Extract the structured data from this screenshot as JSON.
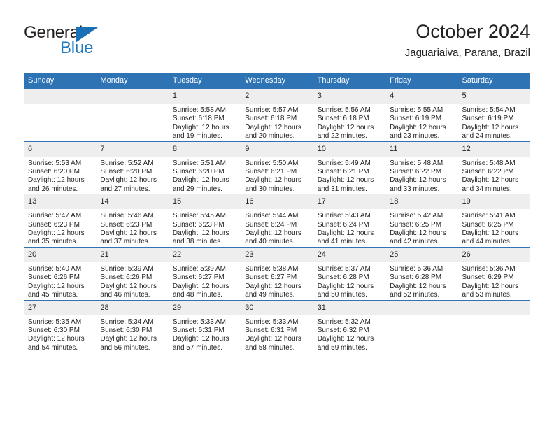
{
  "brand": {
    "name_top": "General",
    "name_bottom": "Blue",
    "triangle_icon": "triangle-icon",
    "color_dark": "#231f20",
    "color_blue": "#1f7ac0"
  },
  "header": {
    "title": "October 2024",
    "subtitle": "Jaguariaiva, Parana, Brazil"
  },
  "colors": {
    "header_bg": "#2e74b5",
    "daynum_bg": "#eeeeee",
    "text": "#222222"
  },
  "weekday_headers": [
    "Sunday",
    "Monday",
    "Tuesday",
    "Wednesday",
    "Thursday",
    "Friday",
    "Saturday"
  ],
  "weeks": [
    [
      {
        "day": ""
      },
      {
        "day": ""
      },
      {
        "day": "1",
        "sunrise": "Sunrise: 5:58 AM",
        "sunset": "Sunset: 6:18 PM",
        "daylight": "Daylight: 12 hours and 19 minutes."
      },
      {
        "day": "2",
        "sunrise": "Sunrise: 5:57 AM",
        "sunset": "Sunset: 6:18 PM",
        "daylight": "Daylight: 12 hours and 20 minutes."
      },
      {
        "day": "3",
        "sunrise": "Sunrise: 5:56 AM",
        "sunset": "Sunset: 6:18 PM",
        "daylight": "Daylight: 12 hours and 22 minutes."
      },
      {
        "day": "4",
        "sunrise": "Sunrise: 5:55 AM",
        "sunset": "Sunset: 6:19 PM",
        "daylight": "Daylight: 12 hours and 23 minutes."
      },
      {
        "day": "5",
        "sunrise": "Sunrise: 5:54 AM",
        "sunset": "Sunset: 6:19 PM",
        "daylight": "Daylight: 12 hours and 24 minutes."
      }
    ],
    [
      {
        "day": "6",
        "sunrise": "Sunrise: 5:53 AM",
        "sunset": "Sunset: 6:20 PM",
        "daylight": "Daylight: 12 hours and 26 minutes."
      },
      {
        "day": "7",
        "sunrise": "Sunrise: 5:52 AM",
        "sunset": "Sunset: 6:20 PM",
        "daylight": "Daylight: 12 hours and 27 minutes."
      },
      {
        "day": "8",
        "sunrise": "Sunrise: 5:51 AM",
        "sunset": "Sunset: 6:20 PM",
        "daylight": "Daylight: 12 hours and 29 minutes."
      },
      {
        "day": "9",
        "sunrise": "Sunrise: 5:50 AM",
        "sunset": "Sunset: 6:21 PM",
        "daylight": "Daylight: 12 hours and 30 minutes."
      },
      {
        "day": "10",
        "sunrise": "Sunrise: 5:49 AM",
        "sunset": "Sunset: 6:21 PM",
        "daylight": "Daylight: 12 hours and 31 minutes."
      },
      {
        "day": "11",
        "sunrise": "Sunrise: 5:48 AM",
        "sunset": "Sunset: 6:22 PM",
        "daylight": "Daylight: 12 hours and 33 minutes."
      },
      {
        "day": "12",
        "sunrise": "Sunrise: 5:48 AM",
        "sunset": "Sunset: 6:22 PM",
        "daylight": "Daylight: 12 hours and 34 minutes."
      }
    ],
    [
      {
        "day": "13",
        "sunrise": "Sunrise: 5:47 AM",
        "sunset": "Sunset: 6:23 PM",
        "daylight": "Daylight: 12 hours and 35 minutes."
      },
      {
        "day": "14",
        "sunrise": "Sunrise: 5:46 AM",
        "sunset": "Sunset: 6:23 PM",
        "daylight": "Daylight: 12 hours and 37 minutes."
      },
      {
        "day": "15",
        "sunrise": "Sunrise: 5:45 AM",
        "sunset": "Sunset: 6:23 PM",
        "daylight": "Daylight: 12 hours and 38 minutes."
      },
      {
        "day": "16",
        "sunrise": "Sunrise: 5:44 AM",
        "sunset": "Sunset: 6:24 PM",
        "daylight": "Daylight: 12 hours and 40 minutes."
      },
      {
        "day": "17",
        "sunrise": "Sunrise: 5:43 AM",
        "sunset": "Sunset: 6:24 PM",
        "daylight": "Daylight: 12 hours and 41 minutes."
      },
      {
        "day": "18",
        "sunrise": "Sunrise: 5:42 AM",
        "sunset": "Sunset: 6:25 PM",
        "daylight": "Daylight: 12 hours and 42 minutes."
      },
      {
        "day": "19",
        "sunrise": "Sunrise: 5:41 AM",
        "sunset": "Sunset: 6:25 PM",
        "daylight": "Daylight: 12 hours and 44 minutes."
      }
    ],
    [
      {
        "day": "20",
        "sunrise": "Sunrise: 5:40 AM",
        "sunset": "Sunset: 6:26 PM",
        "daylight": "Daylight: 12 hours and 45 minutes."
      },
      {
        "day": "21",
        "sunrise": "Sunrise: 5:39 AM",
        "sunset": "Sunset: 6:26 PM",
        "daylight": "Daylight: 12 hours and 46 minutes."
      },
      {
        "day": "22",
        "sunrise": "Sunrise: 5:39 AM",
        "sunset": "Sunset: 6:27 PM",
        "daylight": "Daylight: 12 hours and 48 minutes."
      },
      {
        "day": "23",
        "sunrise": "Sunrise: 5:38 AM",
        "sunset": "Sunset: 6:27 PM",
        "daylight": "Daylight: 12 hours and 49 minutes."
      },
      {
        "day": "24",
        "sunrise": "Sunrise: 5:37 AM",
        "sunset": "Sunset: 6:28 PM",
        "daylight": "Daylight: 12 hours and 50 minutes."
      },
      {
        "day": "25",
        "sunrise": "Sunrise: 5:36 AM",
        "sunset": "Sunset: 6:28 PM",
        "daylight": "Daylight: 12 hours and 52 minutes."
      },
      {
        "day": "26",
        "sunrise": "Sunrise: 5:36 AM",
        "sunset": "Sunset: 6:29 PM",
        "daylight": "Daylight: 12 hours and 53 minutes."
      }
    ],
    [
      {
        "day": "27",
        "sunrise": "Sunrise: 5:35 AM",
        "sunset": "Sunset: 6:30 PM",
        "daylight": "Daylight: 12 hours and 54 minutes."
      },
      {
        "day": "28",
        "sunrise": "Sunrise: 5:34 AM",
        "sunset": "Sunset: 6:30 PM",
        "daylight": "Daylight: 12 hours and 56 minutes."
      },
      {
        "day": "29",
        "sunrise": "Sunrise: 5:33 AM",
        "sunset": "Sunset: 6:31 PM",
        "daylight": "Daylight: 12 hours and 57 minutes."
      },
      {
        "day": "30",
        "sunrise": "Sunrise: 5:33 AM",
        "sunset": "Sunset: 6:31 PM",
        "daylight": "Daylight: 12 hours and 58 minutes."
      },
      {
        "day": "31",
        "sunrise": "Sunrise: 5:32 AM",
        "sunset": "Sunset: 6:32 PM",
        "daylight": "Daylight: 12 hours and 59 minutes."
      },
      {
        "day": ""
      },
      {
        "day": ""
      }
    ]
  ]
}
